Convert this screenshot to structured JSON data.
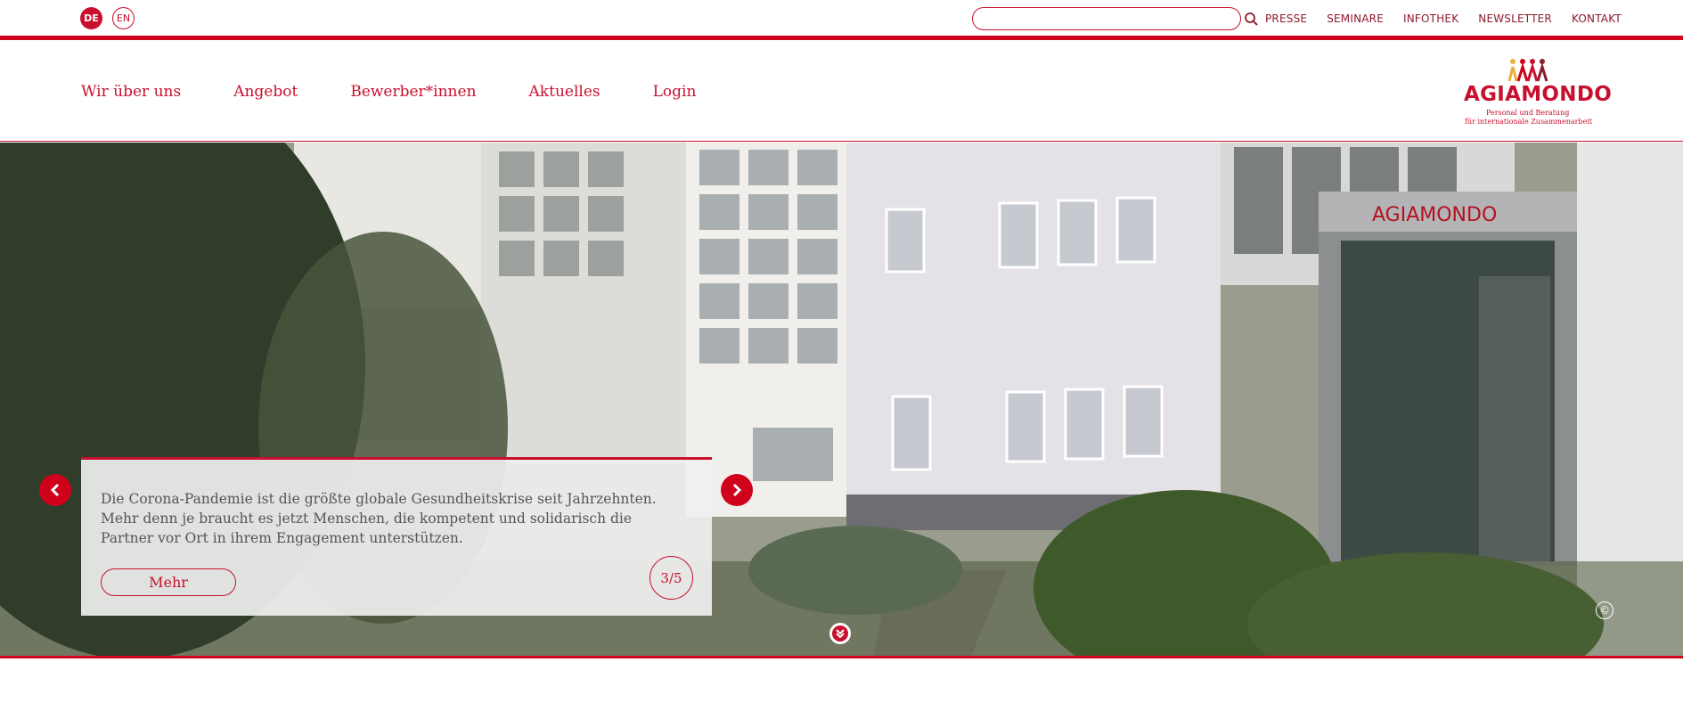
{
  "language": {
    "de": "DE",
    "en": "EN",
    "active": "DE"
  },
  "search": {
    "placeholder": "",
    "value": ""
  },
  "utility_nav": [
    "PRESSE",
    "SEMINARE",
    "INFOTHEK",
    "NEWSLETTER",
    "KONTAKT"
  ],
  "main_nav": [
    "Wir über uns",
    "Angebot",
    "Bewerber*innen",
    "Aktuelles",
    "Login"
  ],
  "logo": {
    "name": "AGIAMONDO",
    "tagline_1": "Personal und Beratung",
    "tagline_2": "für internationale Zusammenarbeit"
  },
  "hero": {
    "caption": "Die Corona-Pandemie ist die größte globale Gesundheitskrise seit Jahrzehnten. Mehr denn je braucht es jetzt Menschen, die kompetent und solidarisch die Partner vor Ort in ihrem Engagement unterstützen.",
    "more_label": "Mehr",
    "counter": "3/5",
    "building_sign": "AGIAMONDO"
  },
  "colors": {
    "brand_red": "#c8102e",
    "accent_red": "#d0021b",
    "dark_red": "#8c1a2b"
  }
}
